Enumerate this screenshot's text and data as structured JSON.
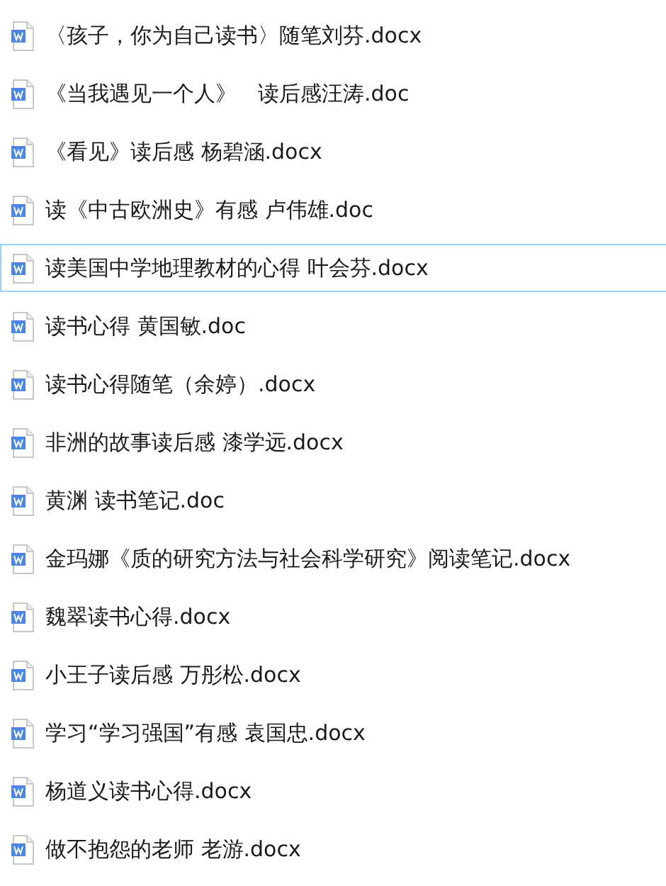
{
  "files": [
    {
      "name": "〈孩子，你为自己读书〉随笔刘芬.docx",
      "selected": false
    },
    {
      "name": "《当我遇见一个人》　读后感汪涛.doc",
      "selected": false
    },
    {
      "name": "《看见》读后感  杨碧涵.docx",
      "selected": false
    },
    {
      "name": "读《中古欧洲史》有感  卢伟雄.doc",
      "selected": false
    },
    {
      "name": "读美国中学地理教材的心得 叶会芬.docx",
      "selected": true
    },
    {
      "name": "读书心得 黄国敏.doc",
      "selected": false
    },
    {
      "name": "读书心得随笔（余婷）.docx",
      "selected": false
    },
    {
      "name": "非洲的故事读后感 漆学远.docx",
      "selected": false
    },
    {
      "name": "黄渊 读书笔记.doc",
      "selected": false
    },
    {
      "name": "金玛娜《质的研究方法与社会科学研究》阅读笔记.docx",
      "selected": false
    },
    {
      "name": "魏翠读书心得.docx",
      "selected": false
    },
    {
      "name": "小王子读后感  万彤松.docx",
      "selected": false
    },
    {
      "name": "学习“学习强国”有感 袁国忠.docx",
      "selected": false
    },
    {
      "name": "杨道义读书心得.docx",
      "selected": false
    },
    {
      "name": "做不抱怨的老师 老游.docx",
      "selected": false
    }
  ]
}
